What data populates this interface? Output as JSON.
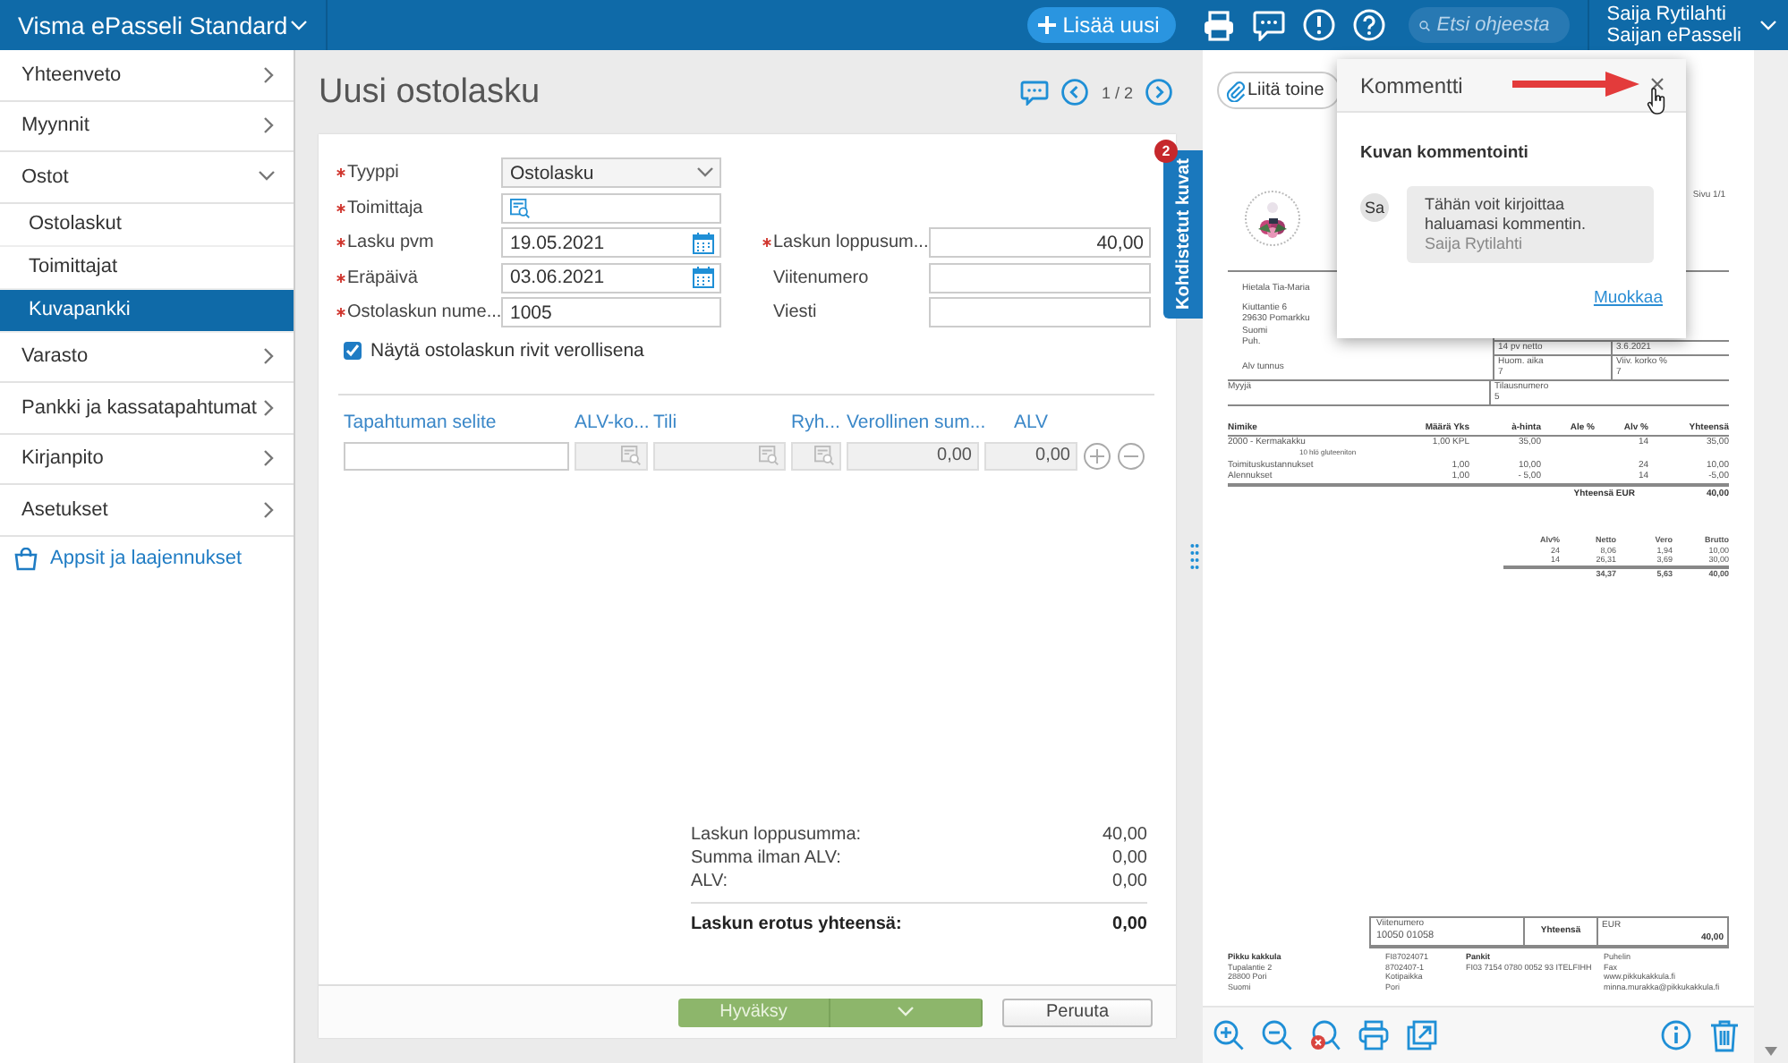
{
  "app_bar": {
    "title": "Visma ePasseli Standard",
    "add_button": "Lisää uusi",
    "search_placeholder": "Etsi ohjeesta",
    "user_name": "Saija Rytilahti",
    "company": "Saijan ePasseli"
  },
  "sidebar": {
    "items": [
      {
        "label": "Yhteenveto",
        "expanded": false,
        "selected": false
      },
      {
        "label": "Myynnit",
        "expanded": false,
        "selected": false
      },
      {
        "label": "Ostot",
        "expanded": true,
        "selected": false,
        "children": [
          {
            "label": "Ostolaskut",
            "selected": false
          },
          {
            "label": "Toimittajat",
            "selected": false
          },
          {
            "label": "Kuvapankki",
            "selected": true
          }
        ]
      },
      {
        "label": "Varasto",
        "expanded": false,
        "selected": false
      },
      {
        "label": "Pankki ja kassatapahtumat",
        "expanded": false,
        "selected": false
      },
      {
        "label": "Kirjanpito",
        "expanded": false,
        "selected": false
      },
      {
        "label": "Asetukset",
        "expanded": false,
        "selected": false
      }
    ],
    "extras_link": "Appsit ja laajennukset"
  },
  "form": {
    "title": "Uusi ostolasku",
    "pager": "1 / 2",
    "side_tab": {
      "label": "Kohdistetut kuvat",
      "badge": "2"
    },
    "rows": [
      {
        "fields": [
          {
            "label": "Tyyppi",
            "required": true,
            "kind": "dropdown",
            "value": "Ostolasku"
          }
        ]
      },
      {
        "fields": [
          {
            "label": "Toimittaja",
            "required": true,
            "kind": "lookup"
          }
        ]
      },
      {
        "fields": [
          {
            "label": "Lasku pvm",
            "required": true,
            "kind": "date",
            "value": "19.05.2021"
          },
          {
            "label": "Laskun loppusum...",
            "required": true,
            "kind": "amount",
            "value": "40,00"
          }
        ]
      },
      {
        "fields": [
          {
            "label": "Eräpäivä",
            "required": true,
            "kind": "date",
            "value": "03.06.2021"
          },
          {
            "label": "Viitenumero",
            "required": false,
            "kind": "text"
          }
        ]
      },
      {
        "fields": [
          {
            "label": "Ostolaskun nume...",
            "required": true,
            "kind": "text",
            "value": "1005"
          },
          {
            "label": "Viesti",
            "required": false,
            "kind": "text"
          }
        ]
      }
    ],
    "checkbox": {
      "label": "Näytä ostolaskun rivit verollisena",
      "checked": true
    },
    "line_columns": [
      "Tapahtuman selite",
      "ALV-ko...",
      "Tili",
      "Ryh...",
      "Verollinen sum...",
      "ALV"
    ],
    "line_cells": [
      {
        "kind": "text",
        "disabled": false
      },
      {
        "kind": "lookup",
        "disabled": true
      },
      {
        "kind": "lookup",
        "disabled": true
      },
      {
        "kind": "lookup",
        "disabled": true
      },
      {
        "kind": "amount",
        "disabled": true,
        "value": "0,00"
      },
      {
        "kind": "amount",
        "disabled": true,
        "value": "0,00"
      }
    ],
    "totals": [
      {
        "label": "Laskun loppusumma:",
        "value": "40,00",
        "emphasis": false
      },
      {
        "label": "Summa ilman ALV:",
        "value": "0,00",
        "emphasis": false
      },
      {
        "label": "ALV:",
        "value": "0,00",
        "emphasis": false
      },
      {
        "label": "Laskun erotus yhteensä:",
        "value": "0,00",
        "emphasis": true
      }
    ],
    "buttons": {
      "approve": "Hyväksy",
      "cancel": "Peruuta"
    }
  },
  "viewer": {
    "attach_button": "Liitä toine",
    "document": {
      "page_label": "Sivu 1/1",
      "customer": [
        "Hietala Tia-Maria",
        "Kiuttantie 6",
        "29630 Pomarkku",
        "Suomi",
        "Puh.",
        "Alv tunnus"
      ],
      "terms": [
        "14 pv netto",
        "3.6.2021"
      ],
      "info": [
        {
          "label": "Huom. aika",
          "value": "7"
        },
        {
          "label": "Viiv. korko %",
          "value": "7"
        }
      ],
      "seller_label": "Myyjä",
      "order": {
        "label": "Tilausnumero",
        "value": "5"
      },
      "columns": [
        "Nimike",
        "Määrä Yks",
        "à-hinta",
        "Ale %",
        "Alv %",
        "Yhteensä"
      ],
      "rows": [
        {
          "item": "2000 - Kermakakku",
          "qty": "1,00 KPL",
          "price": "35,00",
          "vat": "14",
          "total": "35,00",
          "note": "10 hlö gluteeniton"
        },
        {
          "item": "Toimituskustannukset",
          "qty": "1,00",
          "price": "10,00",
          "vat": "24",
          "total": "10,00"
        },
        {
          "item": "Alennukset",
          "qty": "1,00",
          "price": "- 5,00",
          "vat": "14",
          "total": "-5,00"
        }
      ],
      "total": {
        "label": "Yhteensä EUR",
        "value": "40,00"
      },
      "vat_summary": {
        "columns": [
          "Alv%",
          "Netto",
          "Vero",
          "Brutto"
        ],
        "rows": [
          [
            "24",
            "8,06",
            "1,94",
            "10,00"
          ],
          [
            "14",
            "26,31",
            "3,69",
            "30,00"
          ]
        ],
        "totals": [
          "34,37",
          "5,63",
          "40,00"
        ]
      },
      "footer": {
        "reference": {
          "label": "Viitenumero",
          "value": "10050 01058"
        },
        "total_label": "Yhteensä",
        "currency": "EUR",
        "amount": "40,00",
        "columns": [
          {
            "heading_bold": true,
            "lines": [
              "Pikku kakkula",
              "Tupalantie 2",
              "28800 Pori",
              "Suomi"
            ]
          },
          {
            "heading_bold": false,
            "lines": [
              "FI87024071",
              "8702407-1",
              "Kotipaikka",
              "Pori"
            ]
          },
          {
            "heading_bold": true,
            "lines": [
              "Pankit",
              "FI03 7154 0780 0052 93 ITELFIHH"
            ]
          },
          {
            "heading_bold": false,
            "lines": [
              "Puhelin",
              "Fax",
              "www.pikkukakkula.fi",
              "minna.murakka@pikkukakkula.fi"
            ]
          }
        ]
      }
    },
    "comment": {
      "title": "Kommentti",
      "section": "Kuvan kommentointi",
      "avatar": "Sa",
      "text": "Tähän voit kirjoittaa haluamasi kommentin.",
      "author": "Saija Rytilahti",
      "edit_link": "Muokkaa"
    }
  }
}
